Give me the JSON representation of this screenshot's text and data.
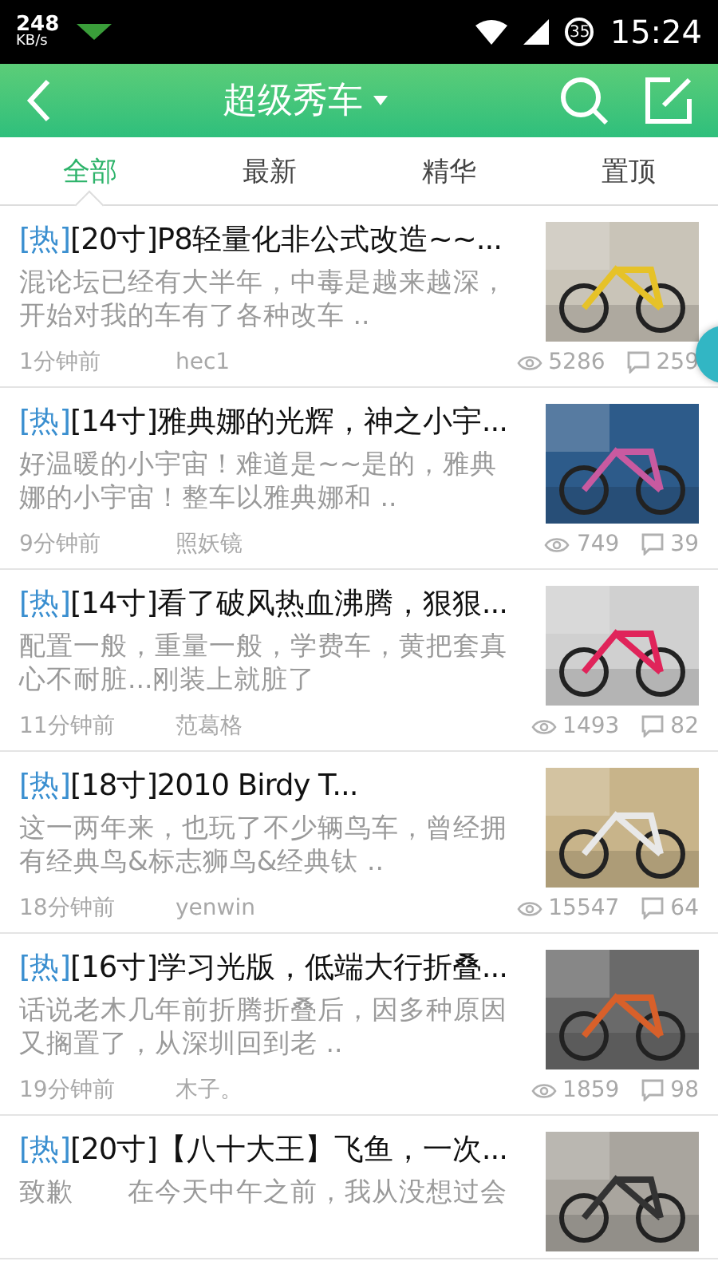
{
  "status_bar": {
    "speed": "248",
    "speed_unit": "KB/s",
    "battery": "35",
    "time": "15:24"
  },
  "header": {
    "title": "超级秀车"
  },
  "tabs": [
    {
      "label": "全部",
      "selected": true
    },
    {
      "label": "最新",
      "selected": false
    },
    {
      "label": "精华",
      "selected": false
    },
    {
      "label": "置顶",
      "selected": false
    }
  ],
  "posts": [
    {
      "tag": "[热]",
      "title": "[20寸]P8轻量化非公式改造~~...",
      "summary": "混论坛已经有大半年，中毒是越来越深，开始对我的车有了各种改车 ..",
      "time": "1分钟前",
      "author": "hec1",
      "views": "5286",
      "comments": "259"
    },
    {
      "tag": "[热]",
      "title": "[14寸]雅典娜的光辉，神之小宇...",
      "summary": "好温暖的小宇宙！难道是~~是的，雅典娜的小宇宙！整车以雅典娜和 ..",
      "time": "9分钟前",
      "author": "照妖镜",
      "views": "749",
      "comments": "39"
    },
    {
      "tag": "[热]",
      "title": "[14寸]看了破风热血沸腾，狠狠...",
      "summary": "配置一般，重量一般，学费车，黄把套真心不耐脏...刚装上就脏了",
      "time": "11分钟前",
      "author": "范葛格",
      "views": "1493",
      "comments": "82"
    },
    {
      "tag": "[热]",
      "title": "[18寸]2010 Birdy T...",
      "summary": "这一两年来，也玩了不少辆鸟车，曾经拥有经典鸟&标志狮鸟&经典钛 ..",
      "time": "18分钟前",
      "author": "yenwin",
      "views": "15547",
      "comments": "64"
    },
    {
      "tag": "[热]",
      "title": "[16寸]学习光版，低端大行折叠...",
      "summary": " 话说老木几年前折腾折叠后，因多种原因又搁置了，从深圳回到老 ..",
      "time": "19分钟前",
      "author": "木子。",
      "views": "1859",
      "comments": "98"
    },
    {
      "tag": "[热]",
      "title": "[20寸]【八十大王】飞鱼，一次...",
      "summary": "致歉　　在今天中午之前，我从没想过会"
    }
  ]
}
